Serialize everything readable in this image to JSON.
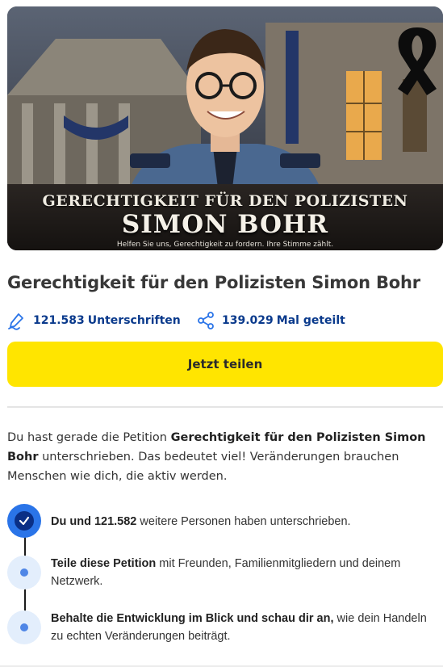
{
  "hero": {
    "title_line1": "GERECHTIGKEIT FÜR DEN POLIZISTEN",
    "title_line2": "SIMON BOHR",
    "subtitle": "Helfen Sie uns, Gerechtigkeit zu fordern. Ihre Stimme zählt."
  },
  "petition": {
    "title": "Gerechtigkeit für den Polizisten Simon Bohr"
  },
  "stats": {
    "signatures_count": "121.583",
    "signatures_label": "Unterschriften",
    "shares_count": "139.029",
    "shares_label": "Mal geteilt"
  },
  "share_button": {
    "label": "Jetzt teilen"
  },
  "intro": {
    "part1": "Du hast gerade die Petition ",
    "bold": "Gerechtigkeit für den Polizisten Simon Bohr",
    "part2": " unterschrieben. Das bedeutet viel! Veränderungen brauchen Menschen wie dich, die aktiv werden."
  },
  "steps": [
    {
      "bold": "Du und 121.582",
      "rest": " weitere Personen haben unterschrieben."
    },
    {
      "bold": "Teile diese Petition",
      "rest": " mit Freunden, Familienmitgliedern und deinem Netzwerk."
    },
    {
      "bold": "Behalte die Entwicklung im Blick und schau dir an,",
      "rest": " wie dein Handeln zu echten Veränderungen beiträgt."
    }
  ],
  "colors": {
    "accent_yellow": "#ffe500",
    "stat_blue": "#0a3a8c",
    "step_done": "#2a74e8",
    "step_pending": "#e3eefc"
  }
}
